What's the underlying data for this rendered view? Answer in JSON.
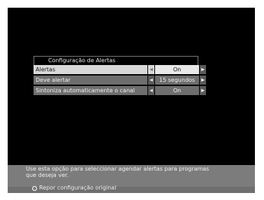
{
  "menu": {
    "title": "Configuração de Alertas",
    "rows": [
      {
        "label": "Alertas",
        "value": "On"
      },
      {
        "label": "Deve alertar",
        "value": "15 segundos"
      },
      {
        "label": "Sintoniza automaticamente o canal",
        "value": "On"
      }
    ],
    "left_arrow": "◀",
    "right_arrow": "▶"
  },
  "help": {
    "line1": "Use esta opção para seleccionar agendar alertas para programas",
    "line2": "que deseja ver.",
    "reset_label": "Repor configuração original"
  }
}
